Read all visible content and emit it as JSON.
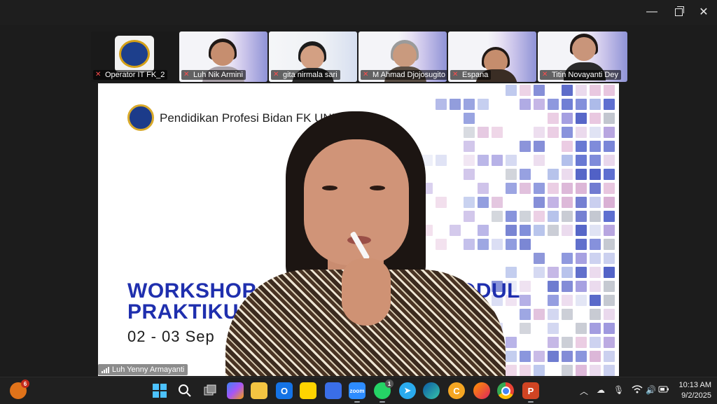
{
  "window": {
    "minimize_glyph": "—",
    "close_glyph": "✕"
  },
  "participants": [
    {
      "name": "Operator IT FK_2"
    },
    {
      "name": "Luh Nik Armini"
    },
    {
      "name": "gita nirmala sari"
    },
    {
      "name": "M Ahmad Djojosugito"
    },
    {
      "name": "Espana"
    },
    {
      "name": "Titin Novayanti Dey"
    }
  ],
  "slide": {
    "header": "Pendidikan Profesi Bidan FK UNDI",
    "title_line1": "WORKSHOP",
    "title_line1_end": "ODUL",
    "title_line2": "PRAKTIKU",
    "date": "02 - 03  Sep"
  },
  "speaker": {
    "name": "Luh Yenny Armayanti"
  },
  "taskbar": {
    "widget_badge": "6",
    "whatsapp_badge": "1",
    "zoom_label": "zoom",
    "time": "10:13 AM",
    "date": "9/2/2025"
  },
  "colors": {
    "slide_title": "#1f2fae",
    "taskbar_bg": "#202020",
    "mute_red": "#ff4d4d"
  }
}
